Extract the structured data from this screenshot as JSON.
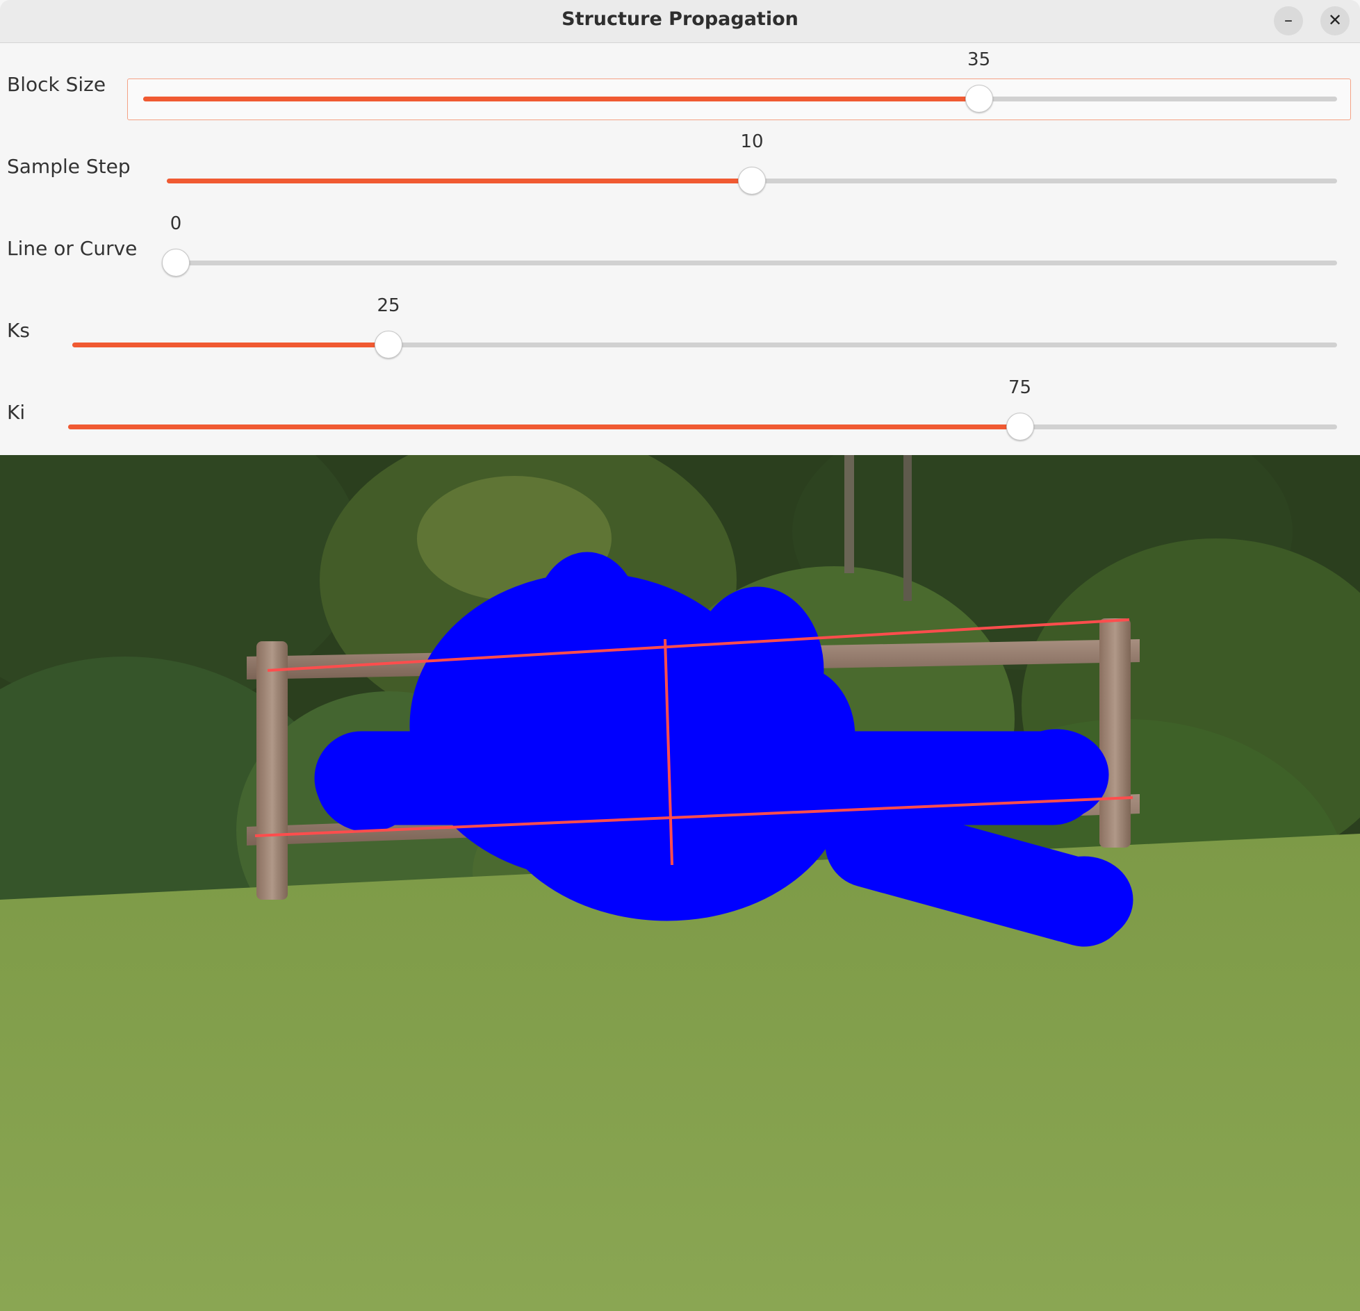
{
  "window": {
    "title": "Structure Propagation",
    "minimize_icon": "minimize-icon",
    "close_icon": "close-icon"
  },
  "sliders": [
    {
      "label": "Block Size",
      "value": "35",
      "fraction": 0.7,
      "focused": true
    },
    {
      "label": "Sample Step",
      "value": "10",
      "fraction": 0.5,
      "focused": false
    },
    {
      "label": "Line or Curve",
      "value": "0",
      "fraction": 0.0,
      "focused": false
    },
    {
      "label": "Ks",
      "value": "25",
      "fraction": 0.25,
      "focused": false
    },
    {
      "label": "Ki",
      "value": "75",
      "fraction": 0.75,
      "focused": false
    }
  ],
  "colors": {
    "accent": "#f05a32",
    "mask": "#0000ff",
    "structure_lines": "#ff4d4d"
  }
}
